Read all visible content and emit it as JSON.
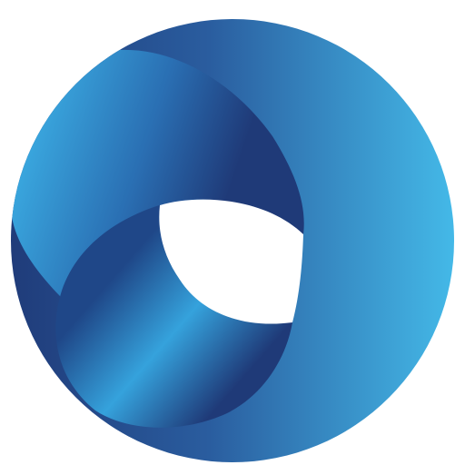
{
  "icon": {
    "name": "swirl-ring-logo",
    "colors": {
      "deep_navy": "#1f3a78",
      "mid_blue": "#2a6fb3",
      "bright_blue": "#35a2dc",
      "sky_blue": "#45bdeb",
      "hole": "#ffffff"
    }
  }
}
